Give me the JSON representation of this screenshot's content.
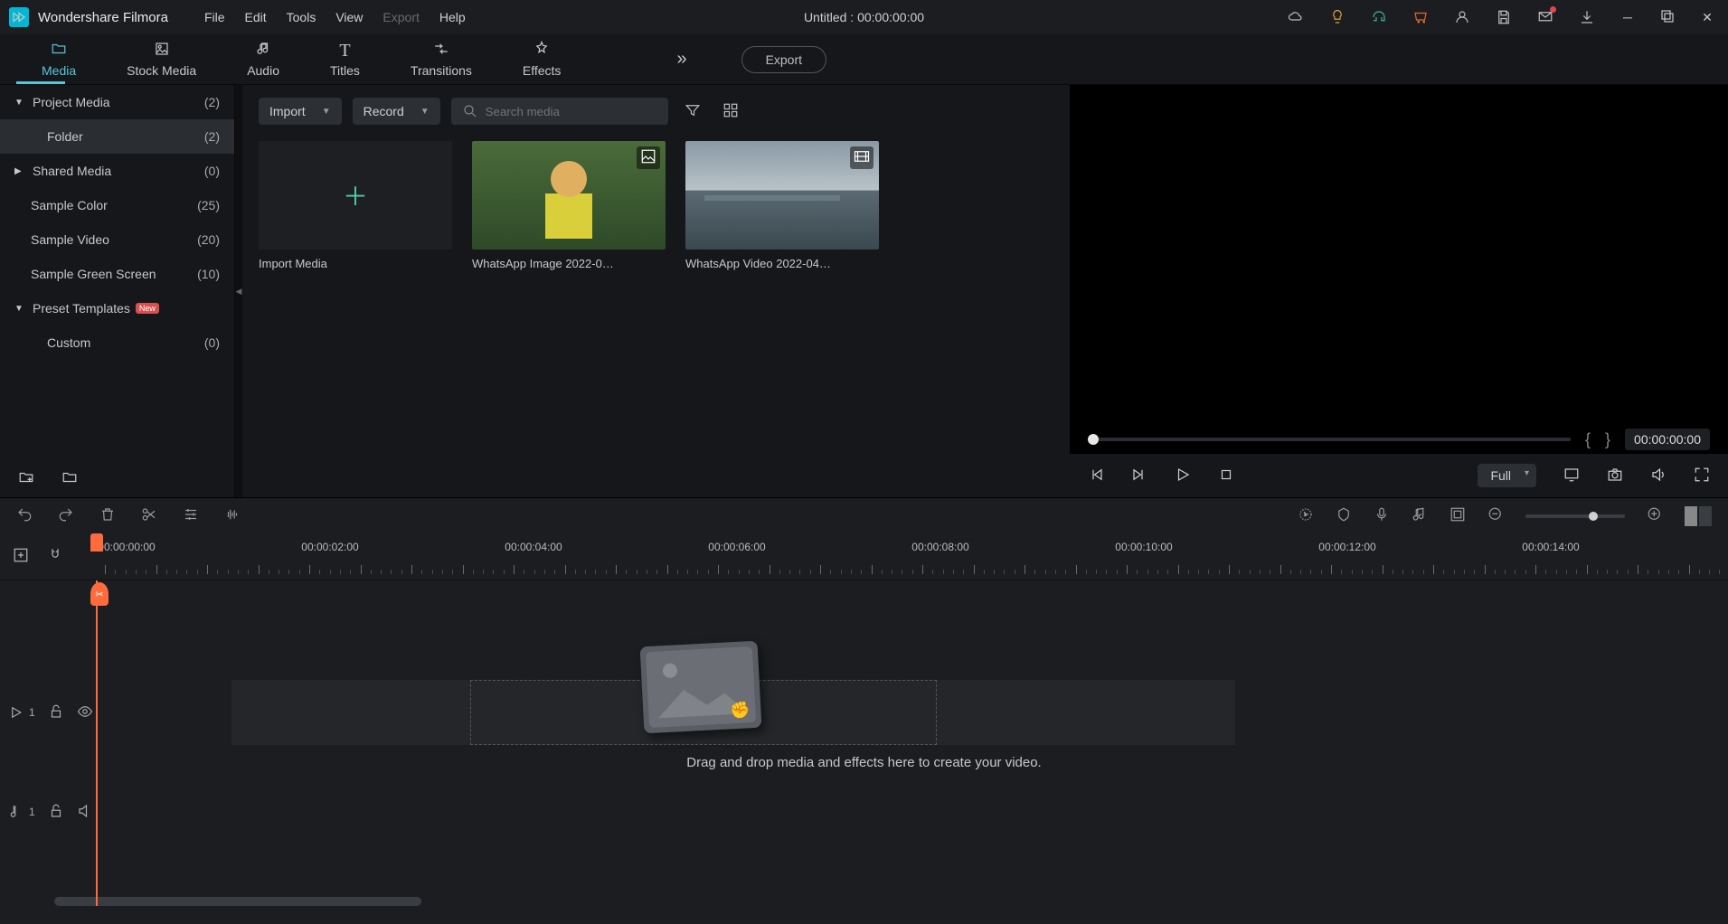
{
  "app": {
    "name": "Wondershare Filmora"
  },
  "menubar": [
    "File",
    "Edit",
    "Tools",
    "View",
    "Export",
    "Help"
  ],
  "titlebar_center": "Untitled : 00:00:00:00",
  "tabs": [
    {
      "label": "Media",
      "icon": "📁",
      "active": true
    },
    {
      "label": "Stock Media",
      "icon": "🖼"
    },
    {
      "label": "Audio",
      "icon": "♪"
    },
    {
      "label": "Titles",
      "icon": "T"
    },
    {
      "label": "Transitions",
      "icon": "⇄"
    },
    {
      "label": "Effects",
      "icon": "✦"
    }
  ],
  "export_btn": "Export",
  "sidebar": [
    {
      "arrow": "▼",
      "label": "Project Media",
      "count": "(2)"
    },
    {
      "indent": true,
      "label": "Folder",
      "count": "(2)",
      "active": true
    },
    {
      "arrow": "▶",
      "label": "Shared Media",
      "count": "(0)"
    },
    {
      "label": "Sample Color",
      "count": "(25)"
    },
    {
      "label": "Sample Video",
      "count": "(20)"
    },
    {
      "label": "Sample Green Screen",
      "count": "(10)"
    },
    {
      "arrow": "▼",
      "label": "Preset Templates",
      "new": true
    },
    {
      "indent": true,
      "label": "Custom",
      "count": "(0)"
    }
  ],
  "media_toolbar": {
    "import": "Import",
    "record": "Record",
    "search_placeholder": "Search media"
  },
  "media_items": [
    {
      "type": "add",
      "label": "Import Media"
    },
    {
      "type": "img",
      "label": "WhatsApp Image 2022-0…"
    },
    {
      "type": "vid",
      "label": "WhatsApp Video 2022-04…"
    }
  ],
  "preview": {
    "marker_in": "{",
    "marker_out": "}",
    "time": "00:00:00:00",
    "quality": "Full"
  },
  "ruler_labels": [
    "00:00:00:00",
    "00:00:02:00",
    "00:00:04:00",
    "00:00:06:00",
    "00:00:08:00",
    "00:00:10:00",
    "00:00:12:00",
    "00:00:14:00"
  ],
  "tracks": {
    "video": "1",
    "audio": "1"
  },
  "drop_text": "Drag and drop media and effects here to create your video."
}
